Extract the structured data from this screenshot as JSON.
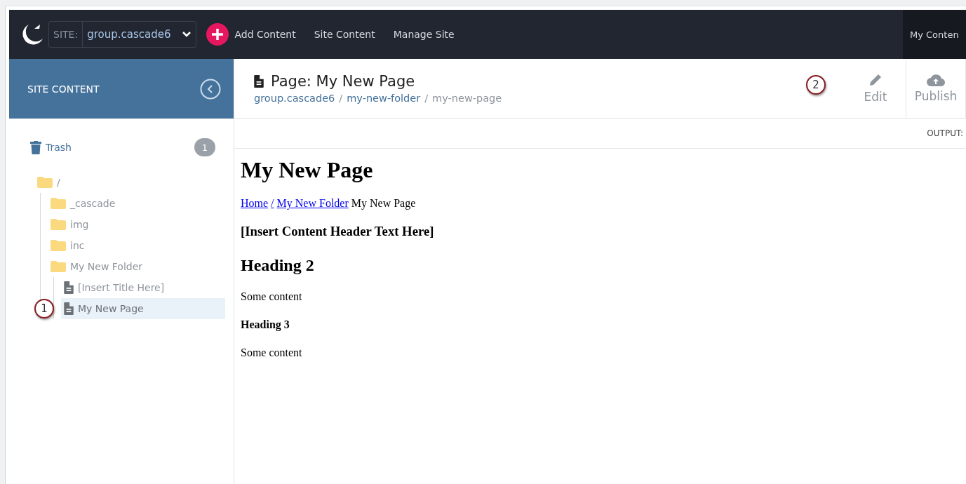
{
  "topbar": {
    "site_label": "SITE:",
    "site_value": "group.cascade6",
    "nav": [
      {
        "label": "Add Content",
        "kind": "add"
      },
      {
        "label": "Site Content",
        "kind": "link"
      },
      {
        "label": "Manage Site",
        "kind": "link"
      }
    ],
    "right_tab": "My Conten"
  },
  "sidebar": {
    "title": "SITE CONTENT",
    "trash": {
      "label": "Trash",
      "count": "1"
    },
    "tree": [
      {
        "label": "/",
        "kind": "folder",
        "selected": false,
        "children": [
          {
            "label": "_cascade",
            "kind": "folder",
            "selected": false
          },
          {
            "label": "img",
            "kind": "folder",
            "selected": false
          },
          {
            "label": "inc",
            "kind": "folder",
            "selected": false
          },
          {
            "label": "My New Folder",
            "kind": "folder",
            "selected": false,
            "children": [
              {
                "label": "[Insert Title Here]",
                "kind": "page",
                "selected": false
              },
              {
                "label": "My New Page",
                "kind": "page",
                "selected": true,
                "callout": "1"
              }
            ]
          }
        ]
      }
    ]
  },
  "header": {
    "title": "Page: My New Page",
    "breadcrumb": [
      {
        "label": "group.cascade6",
        "kind": "link"
      },
      {
        "label": "/",
        "kind": "sep"
      },
      {
        "label": "my-new-folder",
        "kind": "link"
      },
      {
        "label": "/",
        "kind": "sep"
      },
      {
        "label": "my-new-page",
        "kind": "current"
      }
    ],
    "actions": [
      {
        "label": "Edit",
        "kind": "edit",
        "callout": "2"
      },
      {
        "label": "Publish",
        "kind": "publish"
      }
    ]
  },
  "output_label": "OUTPUT:",
  "preview": {
    "title": "My New Page",
    "crumbs": [
      {
        "label": "Home",
        "kind": "link"
      },
      {
        "label": "/",
        "kind": "link"
      },
      {
        "label": "My New Folder",
        "kind": "link"
      },
      {
        "label": "My New Page",
        "kind": "text"
      }
    ],
    "blocks": [
      {
        "kind": "h3",
        "text": "[Insert Content Header Text Here]"
      },
      {
        "kind": "h2",
        "text": "Heading 2"
      },
      {
        "kind": "p",
        "text": "Some content"
      },
      {
        "kind": "h4",
        "text": "Heading 3"
      },
      {
        "kind": "p",
        "text": "Some content"
      }
    ]
  }
}
